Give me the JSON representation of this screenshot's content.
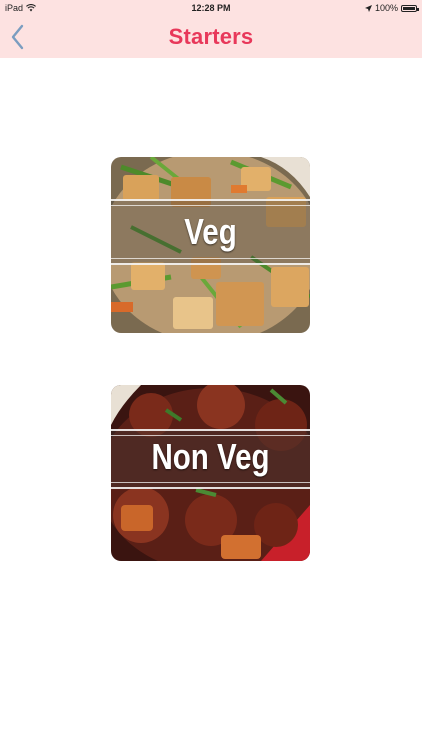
{
  "status_bar": {
    "device": "iPad",
    "time": "12:28 PM",
    "battery": "100%"
  },
  "nav": {
    "title": "Starters"
  },
  "categories": [
    {
      "label": "Veg"
    },
    {
      "label": "Non Veg"
    }
  ],
  "colors": {
    "header_background": "#fde2e1",
    "title": "#e8385a",
    "back_chevron": "#7b9dc0"
  }
}
